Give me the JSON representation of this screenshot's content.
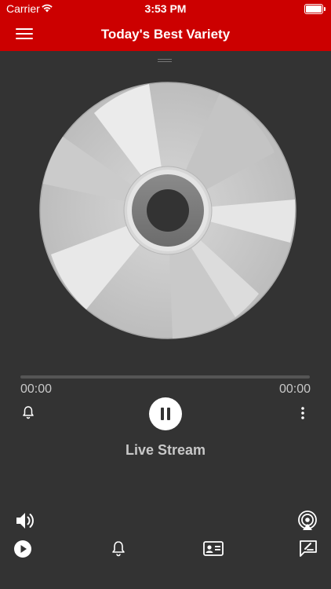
{
  "status_bar": {
    "carrier": "Carrier",
    "time": "3:53 PM"
  },
  "header": {
    "title": "Today's Best Variety"
  },
  "player": {
    "elapsed": "00:00",
    "duration": "00:00",
    "progress": 0,
    "stream_label": "Live Stream"
  },
  "icons": {
    "menu": "hamburger-icon",
    "alarm": "bell-icon",
    "more": "more-vertical-icon",
    "pause": "pause-icon",
    "volume": "volume-icon",
    "airplay": "airplay-icon",
    "play": "play-circle-icon",
    "contact": "contact-card-icon",
    "feedback": "feedback-icon"
  },
  "colors": {
    "accent": "#cc0000",
    "background": "#333333"
  }
}
